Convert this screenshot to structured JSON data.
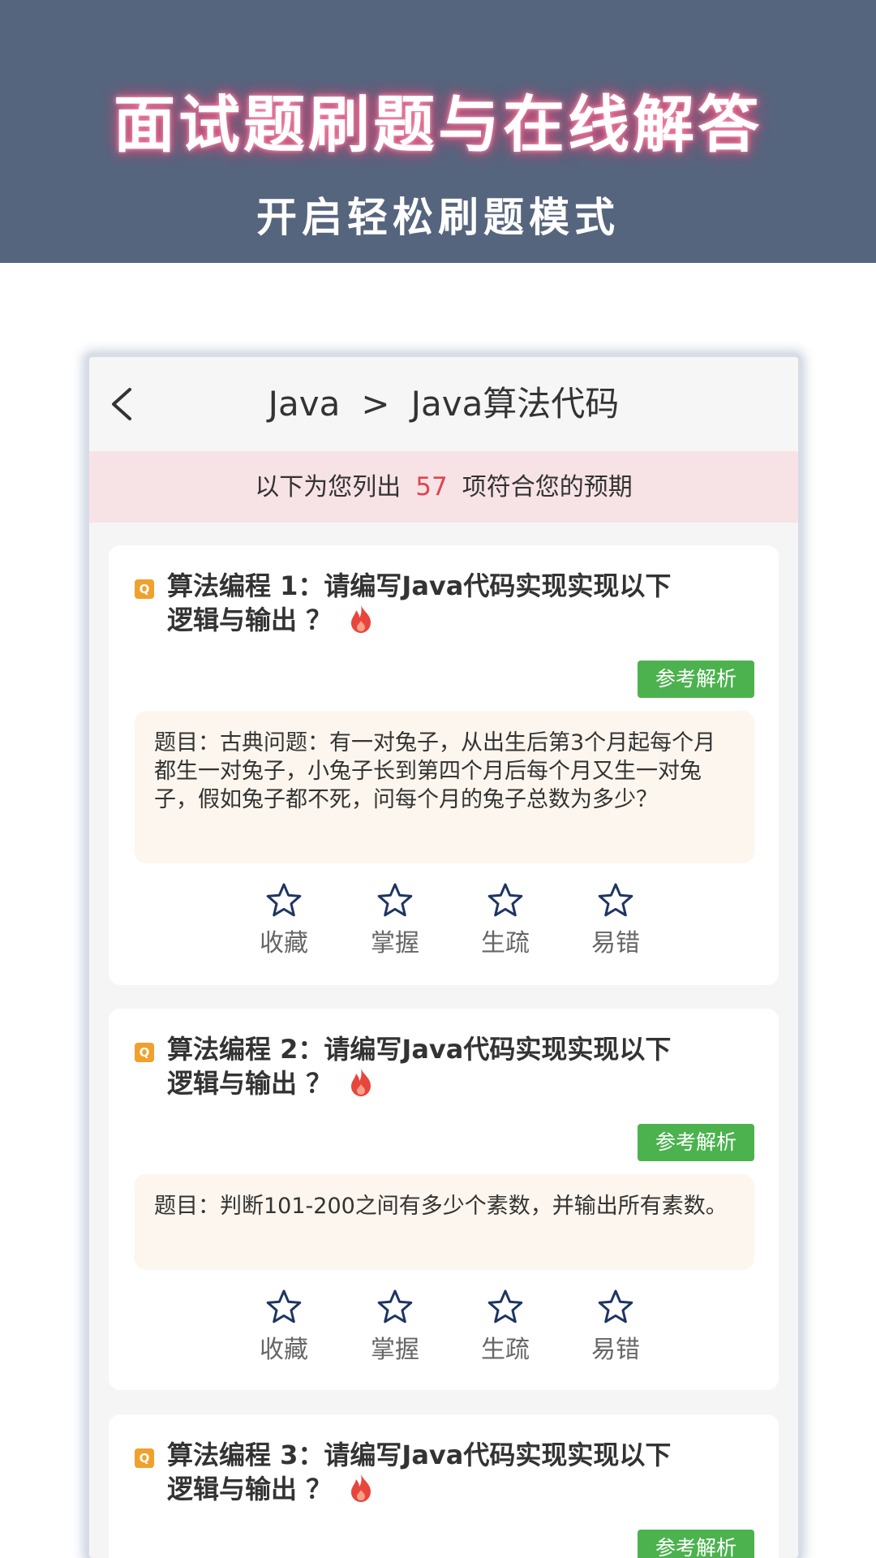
{
  "banner": {
    "title": "面试题刷题与在线解答",
    "subtitle": "开启轻松刷题模式"
  },
  "navbar": {
    "breadcrumb": [
      "Java",
      ">",
      "Java算法代码"
    ]
  },
  "notice": {
    "prefix": "以下为您列出",
    "count": "57",
    "suffix": "项符合您的预期"
  },
  "questions": [
    {
      "badge": "Q",
      "title_line1": "算法编程 1：请编写Java代码实现实现以下",
      "title_line2": "逻辑与输出 ？",
      "ref_label": "参考解析",
      "content": "题目：古典问题：有一对兔子，从出生后第3个月起每个月都生一对兔子，小兔子长到第四个月后每个月又生一对兔子，假如兔子都不死，问每个月的兔子总数为多少？"
    },
    {
      "badge": "Q",
      "title_line1": "算法编程 2：请编写Java代码实现实现以下",
      "title_line2": "逻辑与输出 ？",
      "ref_label": "参考解析",
      "content": "题目：判断101-200之间有多少个素数，并输出所有素数。"
    },
    {
      "badge": "Q",
      "title_line1": "算法编程 3：请编写Java代码实现实现以下",
      "title_line2": "逻辑与输出 ？",
      "ref_label": "参考解析"
    }
  ],
  "actions": [
    "收藏",
    "掌握",
    "生疏",
    "易错"
  ],
  "icons": {
    "back": "chevron-left-icon",
    "badge": "question-badge-icon",
    "hot": "fire-icon",
    "action": "star-outline-icon"
  },
  "colors": {
    "banner_bg": "#56657e",
    "notice_bg": "#f7e3e5",
    "count": "#e0444f",
    "ref_button": "#4cb24e",
    "badge": "#f0a12c",
    "fire": "#e8453c"
  }
}
